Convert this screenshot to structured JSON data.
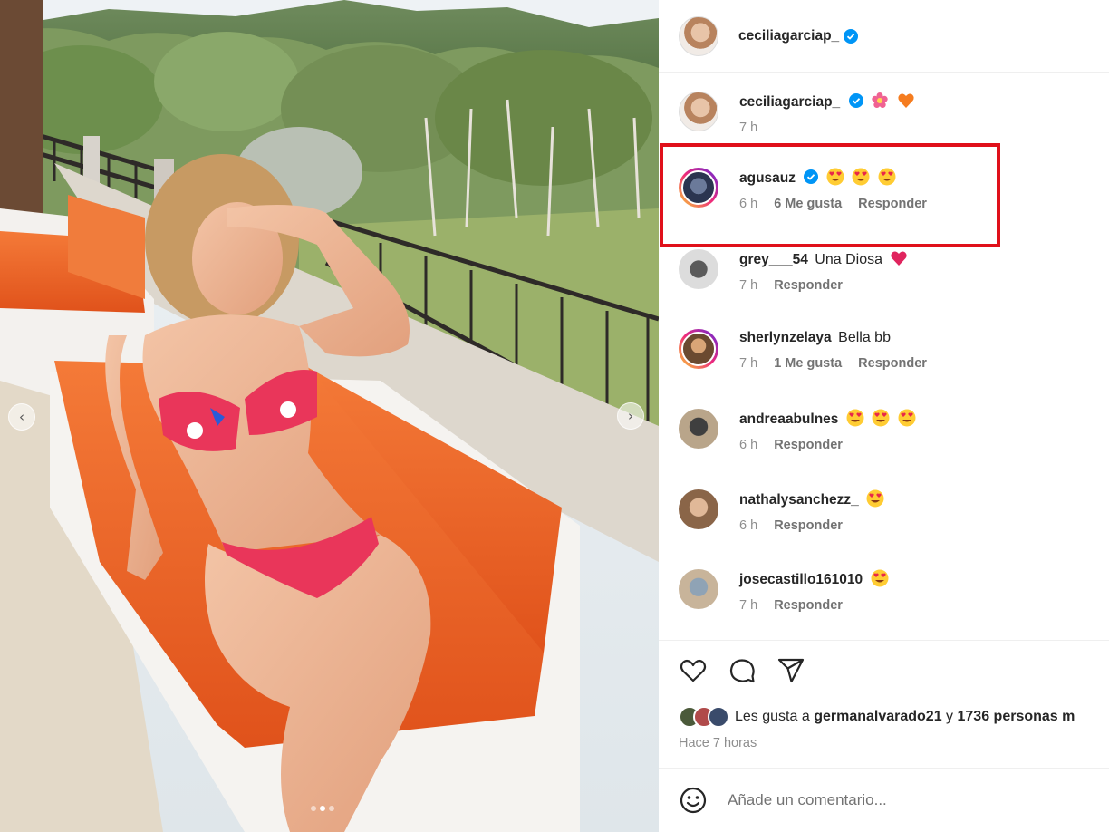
{
  "post": {
    "owner": "ceciliagarciap_",
    "carousel": {
      "prev_icon": "chevron-left-icon",
      "next_icon": "chevron-right-icon",
      "dots": 3,
      "active_dot": 2
    }
  },
  "caption": {
    "username": "ceciliagarciap_",
    "emojis": [
      "flower",
      "orange-heart"
    ],
    "time": "7 h"
  },
  "comments": [
    {
      "username": "agusauz",
      "verified": true,
      "text": "",
      "emojis": [
        "heart-eyes",
        "heart-eyes",
        "heart-eyes"
      ],
      "time": "6 h",
      "likes": "6 Me gusta",
      "reply": "Responder",
      "highlighted": true
    },
    {
      "username": "grey___54",
      "text": "Una Diosa",
      "emojis": [
        "red-heart"
      ],
      "time": "7 h",
      "reply": "Responder"
    },
    {
      "username": "sherlynzelaya",
      "text": "Bella bb",
      "emojis": [],
      "time": "7 h",
      "likes": "1 Me gusta",
      "reply": "Responder"
    },
    {
      "username": "andreaabulnes",
      "text": "",
      "emojis": [
        "heart-eyes",
        "heart-eyes",
        "heart-eyes"
      ],
      "time": "6 h",
      "reply": "Responder"
    },
    {
      "username": "nathalysanchezz_",
      "text": "",
      "emojis": [
        "heart-eyes"
      ],
      "time": "6 h",
      "reply": "Responder"
    },
    {
      "username": "josecastillo161010",
      "text": "",
      "emojis": [
        "heart-eyes"
      ],
      "time": "7 h",
      "reply": "Responder"
    }
  ],
  "actions": {
    "icons": [
      "heart-icon",
      "comment-icon",
      "share-icon"
    ]
  },
  "likes": {
    "prefix": "Les gusta a",
    "user": "germanalvarado21",
    "joiner": "y",
    "count_text": "1736 personas m"
  },
  "posted": "Hace 7 horas",
  "add_comment": {
    "placeholder": "Añade un comentario...",
    "icon": "emoji-icon"
  },
  "colors": {
    "verified": "#0095f6",
    "highlight": "#e0101a",
    "cushion": "#f06a2a"
  }
}
